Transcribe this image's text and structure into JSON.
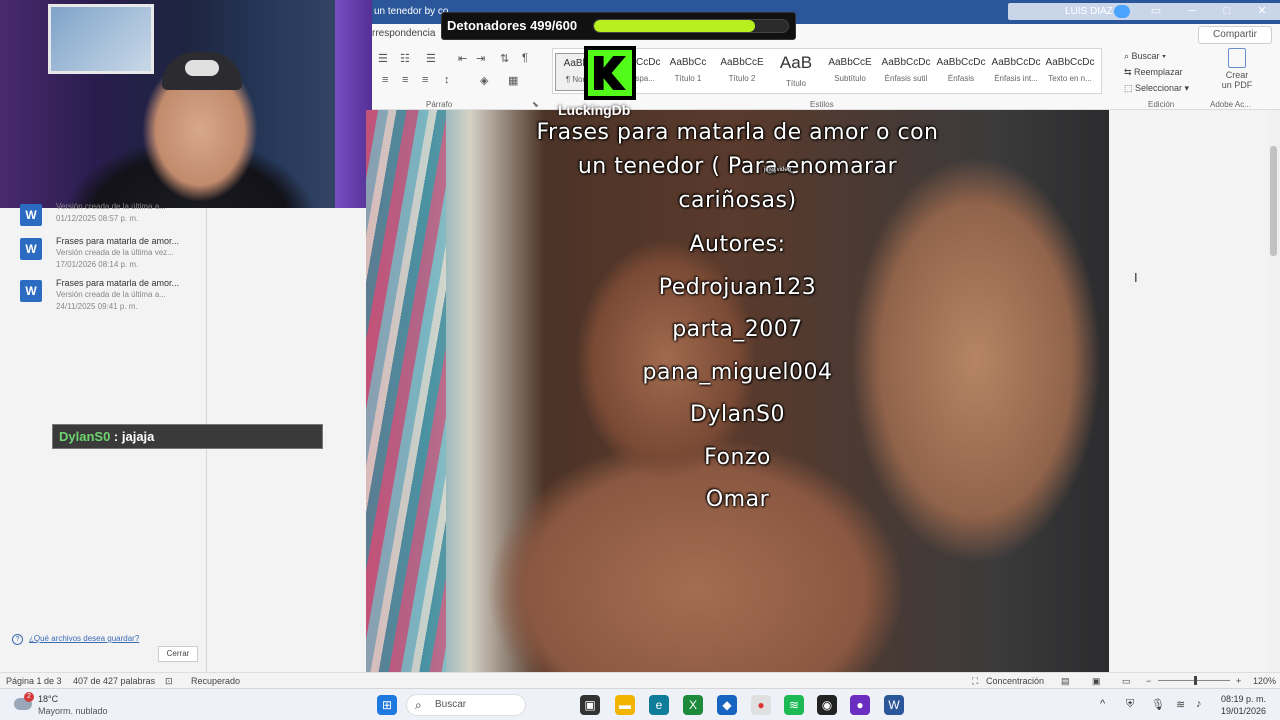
{
  "window": {
    "doc_title": "un tenedor by co",
    "user": "LUIS DIAZ",
    "minimize": "─",
    "maximize": "□",
    "close": "✕"
  },
  "ribbon": {
    "tab_partial": "rrespondencia",
    "share": "Compartir",
    "group_parrafo": "Párrafo",
    "group_estilos": "Estilos",
    "group_edicion": "Edición",
    "group_adobe": "Adobe Ac...",
    "styles": [
      {
        "sample": "AaBbCc",
        "name": "¶ Normal"
      },
      {
        "sample": "AaBbCcDc",
        "name": "Sin espa..."
      },
      {
        "sample": "AaBbCc",
        "name": "Título 1"
      },
      {
        "sample": "AaBbCcE",
        "name": "Título 2"
      },
      {
        "sample": "AaB",
        "name": "Título"
      },
      {
        "sample": "AaBbCcE",
        "name": "Subtítulo"
      },
      {
        "sample": "AaBbCcDc",
        "name": "Énfasis sutil"
      },
      {
        "sample": "AaBbCcDc",
        "name": "Énfasis"
      },
      {
        "sample": "AaBbCcDc",
        "name": "Énfasis int..."
      },
      {
        "sample": "AaBbCcDc",
        "name": "Texto en n..."
      }
    ],
    "buscar": "Buscar",
    "reemplazar": "Reemplazar",
    "seleccionar": "Seleccionar",
    "crear_pdf_1": "Crear",
    "crear_pdf_2": "un PDF"
  },
  "overlay": {
    "detonadores_label": "Detonadores 499/600",
    "detonadores_progress": 0.832,
    "kick_name": "LuckingDb",
    "jitter": "jitter.video",
    "title_lines": [
      "Frases para matarla de amor o con",
      "un tenedor ( Para enomarar",
      "cariñosas)"
    ],
    "authors_heading": "Autores:",
    "authors": [
      "Pedrojuan123",
      "parta_2007",
      "pana_miguel004",
      "DylanS0",
      "Fonzo",
      "Omar"
    ]
  },
  "versions": [
    {
      "name": "",
      "sub": "Versión creada de la última a...",
      "date": "01/12/2025 08:57 p. m."
    },
    {
      "name": "Frases para matarla de amor...",
      "sub": "Versión creada de la última vez...",
      "date": "17/01/2026 08:14 p. m."
    },
    {
      "name": "Frases para matarla de amor...",
      "sub": "Versión creada de la última a...",
      "date": "24/11/2025 09:41 p. m."
    }
  ],
  "chat": {
    "user": "DylanS0",
    "separator": " : ",
    "message": "jajaja"
  },
  "panel": {
    "help": "¿Qué archivos desea guardar?",
    "close": "Cerrar"
  },
  "status": {
    "page": "Página 1 de 3",
    "words": "407 de 427 palabras",
    "recovered": "Recuperado",
    "focus": "Concentración",
    "zoom": "120%"
  },
  "taskbar": {
    "temp": "18°C",
    "condition": "Mayorm. nublado",
    "weather_badge": "2",
    "search": "Buscar",
    "time": "08:19 p. m.",
    "date": "19/01/2026"
  }
}
